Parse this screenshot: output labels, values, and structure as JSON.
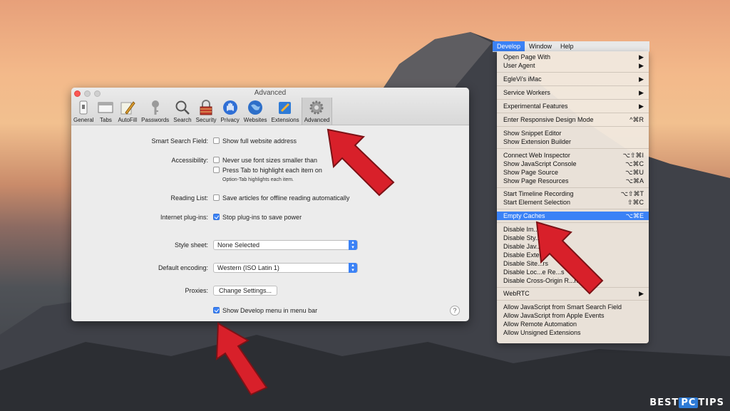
{
  "colors": {
    "accent": "#3b82f6",
    "arrow": "#d8202a"
  },
  "prefs": {
    "title": "Advanced",
    "toolbar": [
      {
        "label": "General",
        "icon": "switch-icon"
      },
      {
        "label": "Tabs",
        "icon": "tabs-icon"
      },
      {
        "label": "AutoFill",
        "icon": "pencil-icon"
      },
      {
        "label": "Passwords",
        "icon": "key-icon"
      },
      {
        "label": "Search",
        "icon": "magnifier-icon"
      },
      {
        "label": "Security",
        "icon": "lock-icon"
      },
      {
        "label": "Privacy",
        "icon": "hand-icon"
      },
      {
        "label": "Websites",
        "icon": "globe-icon"
      },
      {
        "label": "Extensions",
        "icon": "puzzle-icon"
      },
      {
        "label": "Advanced",
        "icon": "gear-icon"
      }
    ],
    "smart_search": {
      "label": "Smart Search Field:",
      "option": "Show full website address"
    },
    "accessibility": {
      "label": "Accessibility:",
      "option1": "Never use font sizes smaller than",
      "option2": "Press Tab to highlight each item on",
      "note": "Option-Tab highlights each item."
    },
    "reading_list": {
      "label": "Reading List:",
      "option": "Save articles for offline reading automatically"
    },
    "plugins": {
      "label": "Internet plug-ins:",
      "option": "Stop plug-ins to save power"
    },
    "style_sheet": {
      "label": "Style sheet:",
      "value": "None Selected"
    },
    "encoding": {
      "label": "Default encoding:",
      "value": "Western (ISO Latin 1)"
    },
    "proxies": {
      "label": "Proxies:",
      "button": "Change Settings..."
    },
    "develop": {
      "option": "Show Develop menu in menu bar"
    },
    "help": "?"
  },
  "menubar": [
    "Develop",
    "Window",
    "Help"
  ],
  "menu": {
    "items": [
      {
        "label": "Open Page With",
        "sc": "▶"
      },
      {
        "label": "User Agent",
        "sc": "▶"
      },
      {
        "label": "EgleVi's iMac",
        "sc": "▶"
      },
      {
        "label": "Service Workers",
        "sc": "▶"
      },
      {
        "label": "Experimental Features",
        "sc": "▶"
      },
      {
        "label": "Enter Responsive Design Mode",
        "sc": "^⌘R"
      },
      {
        "label": "Show Snippet Editor",
        "sc": ""
      },
      {
        "label": "Show Extension Builder",
        "sc": ""
      },
      {
        "label": "Connect Web Inspector",
        "sc": "⌥⇧⌘I"
      },
      {
        "label": "Show JavaScript Console",
        "sc": "⌥⌘C"
      },
      {
        "label": "Show Page Source",
        "sc": "⌥⌘U"
      },
      {
        "label": "Show Page Resources",
        "sc": "⌥⌘A"
      },
      {
        "label": "Start Timeline Recording",
        "sc": "⌥⇧⌘T"
      },
      {
        "label": "Start Element Selection",
        "sc": "⇧⌘C"
      },
      {
        "label": "Empty Caches",
        "sc": "⌥⌘E"
      },
      {
        "label": "Disable Im...",
        "sc": ""
      },
      {
        "label": "Disable Sty...",
        "sc": ""
      },
      {
        "label": "Disable Jav...",
        "sc": ""
      },
      {
        "label": "Disable Exte...",
        "sc": ""
      },
      {
        "label": "Disable Site...rs",
        "sc": ""
      },
      {
        "label": "Disable Loc...e Re...s",
        "sc": ""
      },
      {
        "label": "Disable Cross-Origin R...ns",
        "sc": ""
      },
      {
        "label": "WebRTC",
        "sc": "▶"
      },
      {
        "label": "Allow JavaScript from Smart Search Field",
        "sc": ""
      },
      {
        "label": "Allow JavaScript from Apple Events",
        "sc": ""
      },
      {
        "label": "Allow Remote Automation",
        "sc": ""
      },
      {
        "label": "Allow Unsigned Extensions",
        "sc": ""
      }
    ]
  },
  "logo": {
    "pre": "BEST",
    "mid": "PC",
    "post": "TIPS"
  }
}
